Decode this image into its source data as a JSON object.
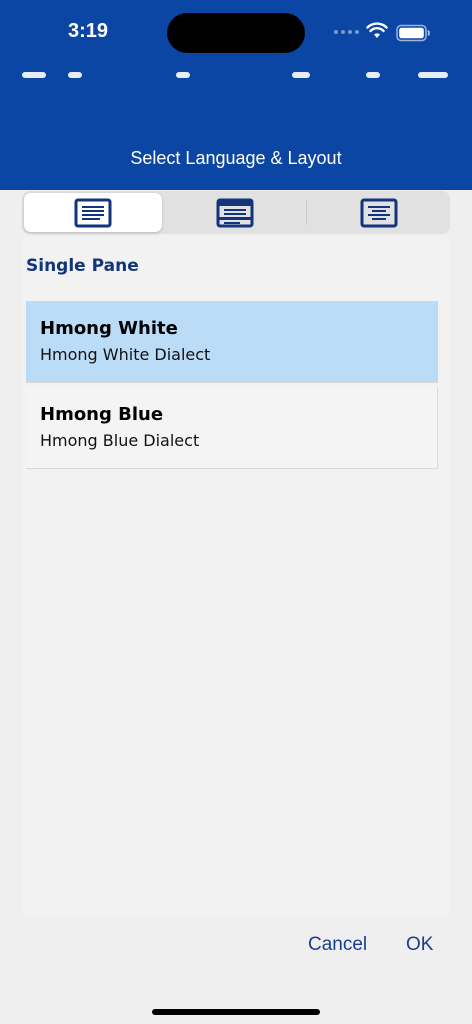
{
  "status_bar": {
    "time": "3:19"
  },
  "header": {
    "title": "Select Language & Layout"
  },
  "layout_tabs": [
    {
      "icon": "single-pane-layout-icon",
      "selected": true
    },
    {
      "icon": "dual-pane-layout-icon",
      "selected": false
    },
    {
      "icon": "interlinear-layout-icon",
      "selected": false
    }
  ],
  "section": {
    "label": "Single Pane"
  },
  "languages": [
    {
      "title": "Hmong White",
      "subtitle": "Hmong White Dialect",
      "selected": true
    },
    {
      "title": "Hmong Blue",
      "subtitle": "Hmong Blue Dialect",
      "selected": false
    }
  ],
  "actions": {
    "cancel": "Cancel",
    "ok": "OK"
  },
  "colors": {
    "header_bg": "#0c46a4",
    "selected_row": "#bbdcf7",
    "accent_text": "#12347a",
    "icon_blue": "#12347a"
  }
}
